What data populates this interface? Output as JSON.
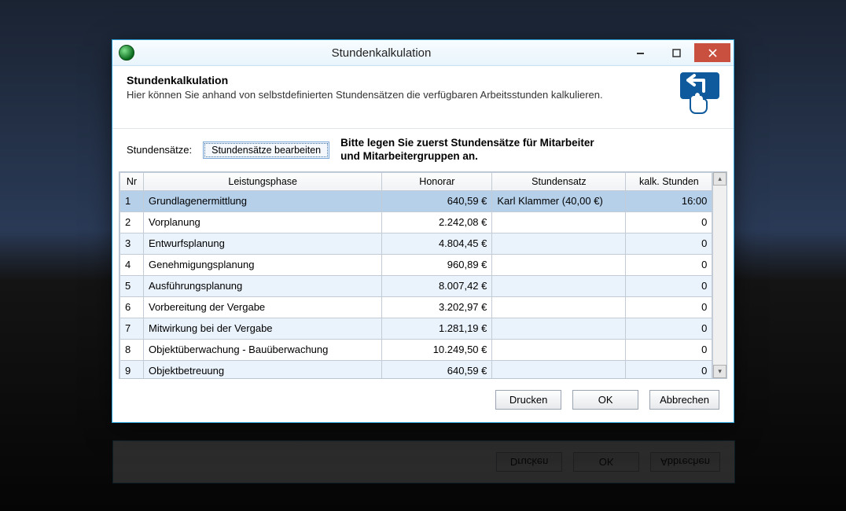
{
  "window": {
    "title": "Stundenkalkulation"
  },
  "header": {
    "title": "Stundenkalkulation",
    "desc": "Hier können Sie anhand von selbstdefinierten Stundensätzen die verfügbaren Arbeitsstunden kalkulieren."
  },
  "toolbar": {
    "label": "Stundensätze:",
    "edit_button": "Stundensätze bearbeiten",
    "hint_line1": "Bitte legen Sie zuerst Stundensätze für Mitarbeiter",
    "hint_line2": "und Mitarbeitergruppen an."
  },
  "columns": {
    "nr": "Nr",
    "phase": "Leistungsphase",
    "honorar": "Honorar",
    "satz": "Stundensatz",
    "kalk": "kalk. Stunden"
  },
  "rows": [
    {
      "nr": "1",
      "phase": "Grundlagenermittlung",
      "honorar": "640,59 €",
      "satz": "Karl Klammer (40,00 €)",
      "kalk": "16:00",
      "selected": true
    },
    {
      "nr": "2",
      "phase": "Vorplanung",
      "honorar": "2.242,08 €",
      "satz": "",
      "kalk": "0"
    },
    {
      "nr": "3",
      "phase": "Entwurfsplanung",
      "honorar": "4.804,45 €",
      "satz": "",
      "kalk": "0"
    },
    {
      "nr": "4",
      "phase": "Genehmigungsplanung",
      "honorar": "960,89 €",
      "satz": "",
      "kalk": "0"
    },
    {
      "nr": "5",
      "phase": "Ausführungsplanung",
      "honorar": "8.007,42 €",
      "satz": "",
      "kalk": "0"
    },
    {
      "nr": "6",
      "phase": "Vorbereitung der Vergabe",
      "honorar": "3.202,97 €",
      "satz": "",
      "kalk": "0"
    },
    {
      "nr": "7",
      "phase": "Mitwirkung bei der Vergabe",
      "honorar": "1.281,19 €",
      "satz": "",
      "kalk": "0"
    },
    {
      "nr": "8",
      "phase": "Objektüberwachung - Bauüberwachung",
      "honorar": "10.249,50 €",
      "satz": "",
      "kalk": "0"
    },
    {
      "nr": "9",
      "phase": "Objektbetreuung",
      "honorar": "640,59 €",
      "satz": "",
      "kalk": "0"
    }
  ],
  "footer": {
    "print": "Drucken",
    "ok": "OK",
    "cancel": "Abbrechen"
  },
  "colors": {
    "accent": "#0f5a9c",
    "close": "#c94f3f"
  }
}
